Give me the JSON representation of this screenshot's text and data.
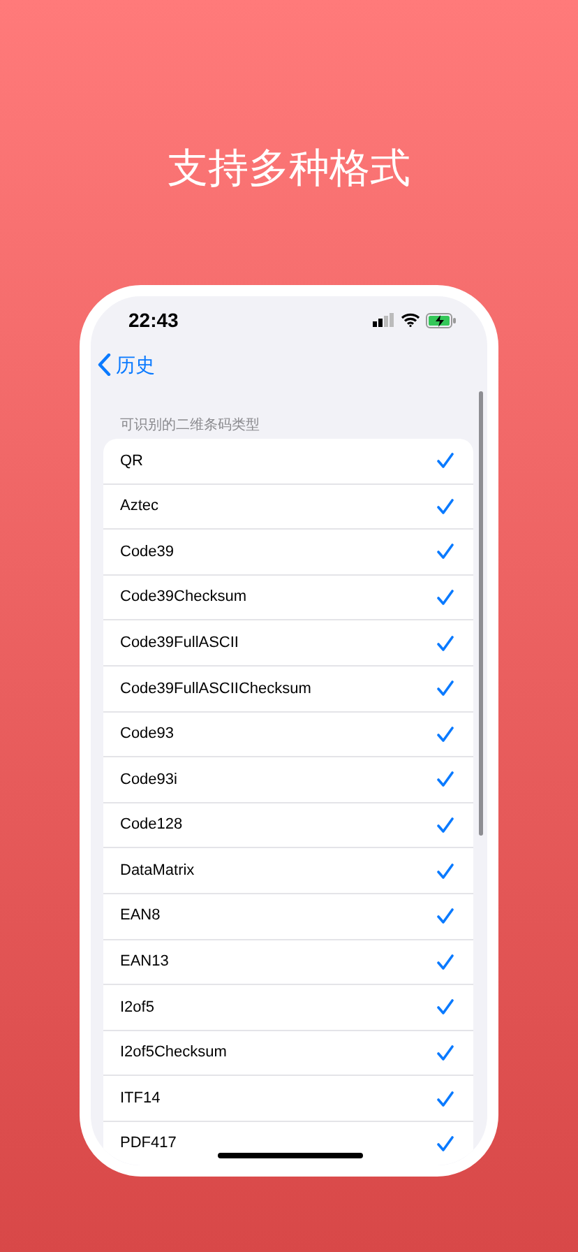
{
  "headline": "支持多种格式",
  "status_bar": {
    "time": "22:43"
  },
  "nav": {
    "back_label": "历史"
  },
  "section": {
    "header": "可识别的二维条码类型",
    "items": [
      {
        "name": "QR",
        "checked": true
      },
      {
        "name": "Aztec",
        "checked": true
      },
      {
        "name": "Code39",
        "checked": true
      },
      {
        "name": "Code39Checksum",
        "checked": true
      },
      {
        "name": "Code39FullASCII",
        "checked": true
      },
      {
        "name": "Code39FullASCIIChecksum",
        "checked": true
      },
      {
        "name": "Code93",
        "checked": true
      },
      {
        "name": "Code93i",
        "checked": true
      },
      {
        "name": "Code128",
        "checked": true
      },
      {
        "name": "DataMatrix",
        "checked": true
      },
      {
        "name": "EAN8",
        "checked": true
      },
      {
        "name": "EAN13",
        "checked": true
      },
      {
        "name": "I2of5",
        "checked": true
      },
      {
        "name": "I2of5Checksum",
        "checked": true
      },
      {
        "name": "ITF14",
        "checked": true
      },
      {
        "name": "PDF417",
        "checked": true
      }
    ]
  }
}
